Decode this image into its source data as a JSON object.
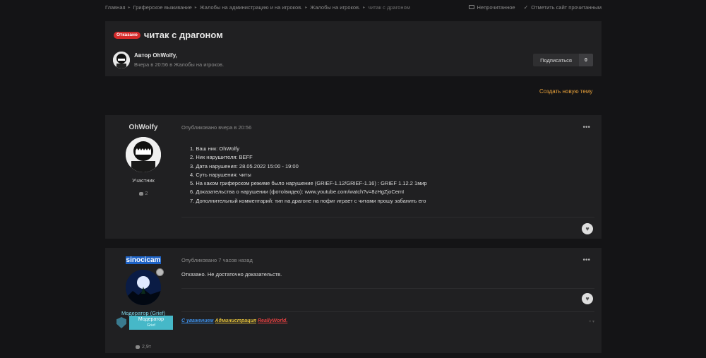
{
  "breadcrumb": {
    "items": [
      "Главная",
      "Гриферское выживание",
      "Жалобы на администрацию и на игроков.",
      "Жалобы на игроков."
    ],
    "current": "читак с драгоном"
  },
  "top_actions": {
    "unread": "Непрочитанное",
    "mark_read": "Отметить сайт прочитанным"
  },
  "thread": {
    "badge": "Отказано",
    "title": "читак с драгоном",
    "author_line": "Автор OhWolfy,",
    "meta": "Вчера в 20:56 в Жалобы на игроков.",
    "follow_label": "Подписаться",
    "follow_count": "0"
  },
  "new_topic": "Создать новую тему",
  "posts": [
    {
      "username": "OhWolfy",
      "role": "Участник",
      "post_count": "2",
      "published": "Опубликовано вчера в 20:56",
      "lines": [
        "1. Ваш ник: OhWolfy",
        "2. Ник нарушителя: BEFF",
        "3. Дата нарушения: 28.05.2022 15:00 - 19:00",
        "4. Суть нарушения: читы",
        "5. На каком гриферском режиме было нарушение (GRIEF-1.12/GRIEF-1.16) : GRIEF 1.12.2 1мир",
        "6. Доказательства о нарушении (фото/видео): www.youtube.com/watch?v=8zHgZjoCemI",
        "7. Дополнительный комментарий: тип на драгоне на пофиг играет с читами прошу забанить его"
      ]
    },
    {
      "username": "sinocicam",
      "role": "Модератор (Grief)",
      "post_count": "2,9т",
      "published": "Опубликовано 7 часов назад",
      "text": "Отказано. Не достаточно доказательств.",
      "badge_title": "Модератор",
      "badge_sub": "Grief",
      "signature": {
        "part1": "С уважением",
        "part2": "Администрация",
        "part3": "ReallyWorld."
      }
    }
  ],
  "icons": [
    "unread-icon",
    "check-icon",
    "heart-icon",
    "comment-icon",
    "more-icon",
    "shield-icon"
  ]
}
